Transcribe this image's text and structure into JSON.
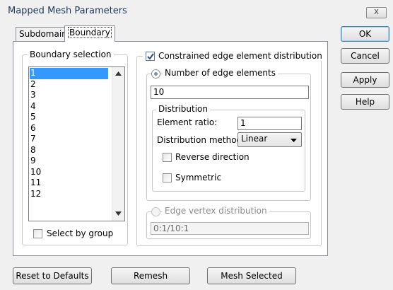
{
  "window": {
    "title": "Mapped Mesh Parameters",
    "close_label": "X"
  },
  "tabs": [
    {
      "label": "Subdomain"
    },
    {
      "label": "Boundary"
    }
  ],
  "side_buttons": {
    "ok": "OK",
    "cancel": "Cancel",
    "apply": "Apply",
    "help": "Help"
  },
  "boundary_selection": {
    "legend": "Boundary selection",
    "items": [
      "1",
      "2",
      "3",
      "4",
      "5",
      "6",
      "7",
      "8",
      "9",
      "10",
      "11",
      "12"
    ],
    "selected": "1",
    "select_by_group_label": "Select by group",
    "select_by_group_checked": false
  },
  "constrained": {
    "checkbox_label": "Constrained edge element distribution",
    "checked": true,
    "number_of_edge_elements_label": "Number of edge elements",
    "number_value": "10",
    "distribution": {
      "legend": "Distribution",
      "element_ratio_label": "Element ratio:",
      "element_ratio_value": "1",
      "method_label": "Distribution method:",
      "method_value": "Linear",
      "reverse_label": "Reverse direction",
      "symmetric_label": "Symmetric"
    },
    "edge_vertex_label": "Edge vertex distribution",
    "edge_vertex_value": "0:1/10:1"
  },
  "bottom_buttons": {
    "reset": "Reset to Defaults",
    "remesh": "Remesh",
    "mesh_selected": "Mesh Selected"
  },
  "colors": {
    "selection": "#3399ff",
    "dialog_bg": "#f0f0f0",
    "title_text": "#1e395b"
  }
}
